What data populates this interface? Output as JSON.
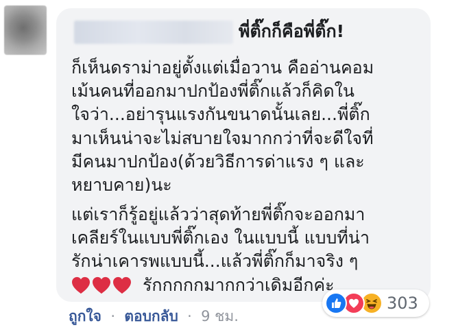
{
  "comment": {
    "title": "พี่ติ๊กก็คือพี่ติ๊ก!",
    "paragraph1": [
      "ก็เห็นดราม่าอยู่ตั้งแต่เมื่อวาน คืออ่านคอม",
      "เม้นคนที่ออกมาปกป้องพี่ติ๊กแล้วก็คิดใน",
      "ใจว่า...อย่ารุนแรงกันขนาดนั้นเลย...พี่ติ๊ก",
      "มาเห็นน่าจะไม่สบายใจมากกว่าที่จะดีใจที่",
      "มีคนมาปกป้อง(ด้วยวิธีการด่าแรง ๆ และ",
      "หยาบคาย)นะ"
    ],
    "paragraph2": [
      "แต่เราก็รู้อยู่แล้วว่าสุดท้ายพี่ติ๊กจะออกมา",
      "เคลียร์ในแบบพี่ติ๊กเอง ในแบบนี้ แบบที่น่า",
      "รักน่าเคารพแบบนี้...แล้วพี่ติ๊กก็มาจริง ๆ"
    ],
    "last_line": "รักกกกกมากกว่าเดิมอีกค่ะ",
    "hearts_icon": "red-heart-emoji",
    "heart_count": 3
  },
  "reactions": {
    "icons": [
      "like-icon",
      "love-icon",
      "haha-icon"
    ],
    "count": "303"
  },
  "footer": {
    "like_label": "ถูกใจ",
    "reply_label": "ตอบกลับ",
    "separator": "·",
    "time": "9 ชม."
  },
  "colors": {
    "bubble": "#f2f3f5",
    "link": "#385898",
    "meta": "#90949c",
    "like": "#1877f2",
    "love": "#f33e58",
    "haha": "#f7b125",
    "heart": "#dd2e44"
  }
}
